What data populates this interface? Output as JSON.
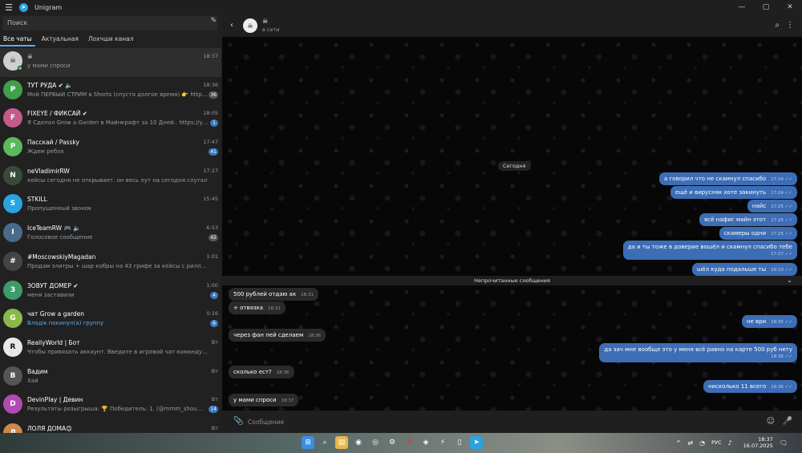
{
  "window": {
    "title": "Unigram",
    "controls": [
      "—",
      "▢",
      "✕"
    ]
  },
  "sidebar": {
    "search_placeholder": "Поиск",
    "tabs": [
      "Все чаты",
      "Актуальная",
      "Лохчши канал"
    ],
    "chats": [
      {
        "name": "☠",
        "message": "у мами спроси",
        "time": "18:37",
        "badge": "",
        "avatar_color": "#cfcfcf",
        "avatar_text": "☠",
        "selected": true,
        "online": true
      },
      {
        "name": "ТУТ РУДА ✔ 🔈",
        "message": "Мой ПЕРВЫЙ СТРИМ в Shorts (спустя долгое время) 👉 https:/...",
        "time": "18:36",
        "badge": "36",
        "badge_muted": true,
        "avatar_color": "#3fa04a",
        "avatar_text": "Р"
      },
      {
        "name": "FIXEYE / ФИКСАЙ ✔",
        "message": "Я Сделал Grow a Garden в Майнкрафт за 10 Дней.. https://yout...",
        "time": "18:05",
        "badge": "1",
        "avatar_color": "#c25b8a",
        "avatar_text": "F"
      },
      {
        "name": "Пасскай / Passky",
        "message": "Ждем ребзя",
        "time": "17:47",
        "badge": "41",
        "avatar_color": "#5cb85c",
        "avatar_text": "P"
      },
      {
        "name": "neVladimirRW",
        "message": "кейсы сегодня не открывает. он весь лут на сегодня слутал",
        "time": "17:27",
        "badge": "",
        "avatar_color": "#3a4a3a",
        "avatar_text": "N"
      },
      {
        "name": "STKILL",
        "message": "Пропущенный звонок",
        "time": "15:45",
        "badge": "",
        "avatar_color": "#2aa3e0",
        "avatar_text": "S"
      },
      {
        "name": "IceTeamRW 🎮 🔈",
        "message": "Голосовое сообщение",
        "time": "6:53",
        "badge": "42",
        "badge_muted": true,
        "avatar_color": "#4a6a8a",
        "avatar_text": "I"
      },
      {
        "name": "#MoscowskiyMagadan",
        "message": "Продам элитры + шар кобры на 43 грифе за кейсы с рилликами. Пи...",
        "time": "1:01",
        "badge": "",
        "avatar_color": "#444",
        "avatar_text": "#"
      },
      {
        "name": "ЗОВУТ ДОМЕР ✔",
        "message": "меня заставили",
        "time": "1:00",
        "badge": "4",
        "avatar_color": "#3f9a6a",
        "avatar_text": "З"
      },
      {
        "name": "чат Grow a garden",
        "message": "Владік покинул(а) группу",
        "time": "0:16",
        "badge": "6",
        "avatar_color": "#8ab84a",
        "avatar_text": "G",
        "blue": true
      },
      {
        "name": "ReallyWorld | Бот",
        "message": "Чтобы привязать аккаунт. Введите в игровой чат команду: /link ctoek...",
        "time": "Вт",
        "badge": "",
        "avatar_color": "#e8e8e8",
        "avatar_text": "R"
      },
      {
        "name": "Вадим",
        "message": "Хай",
        "time": "Вт",
        "badge": "",
        "avatar_color": "#555",
        "avatar_text": "В"
      },
      {
        "name": "DevinPlay | Девин",
        "message": "Результаты розыгрыша: 🏆 Победитель: 1. (@mmm_shou...",
        "time": "Вт",
        "badge": "14",
        "avatar_color": "#b24ab2",
        "avatar_text": "D"
      },
      {
        "name": "ЛОЛЯ ДОМА😊",
        "message": "",
        "time": "Вт",
        "badge": "",
        "avatar_color": "#c98a4a",
        "avatar_text": "Л"
      }
    ]
  },
  "chat": {
    "header_name": "☠",
    "header_status": "в сети",
    "date_label": "Сегодня",
    "unread_label": "Непрочитанные сообщения",
    "composer_placeholder": "Сообщение",
    "outgoing_top": [
      {
        "text": "а говорил что не скамнул спасибо",
        "time": "17:24"
      },
      {
        "text": "ещё и вирусняк хоте закинуть",
        "time": "17:24"
      },
      {
        "text": "найс",
        "time": "17:25"
      },
      {
        "text": "всё нафиг майн этот",
        "time": "17:25"
      },
      {
        "text": "скамеры одни",
        "time": "17:25"
      },
      {
        "text": "да и ты тоже в доверие вошёл и скамнул спасибо тебе",
        "time": "17:27"
      },
      {
        "text": "шёл куда подальше ты",
        "time": "18:10"
      }
    ],
    "incoming": [
      {
        "text": "500 рублей отдаю ак",
        "time": "18:31"
      },
      {
        "text": "+ отвязка",
        "time": "18:31"
      },
      {
        "text": "через фан пей сделаем",
        "time": "18:36"
      },
      {
        "text": "сколько ест?",
        "time": "18:36"
      },
      {
        "text": "у мами спроси",
        "time": "18:37"
      }
    ],
    "outgoing_bottom": [
      {
        "text": "не ври",
        "time": "18:35"
      },
      {
        "text": "да зач мне вообще это у меня всё равно на карте 500 руб нету",
        "time": "18:36"
      },
      {
        "text": "нисколько 11 всего",
        "time": "18:36"
      }
    ]
  },
  "taskbar": {
    "lang": "РУС",
    "time": "18:37",
    "date": "16.07.2025"
  }
}
